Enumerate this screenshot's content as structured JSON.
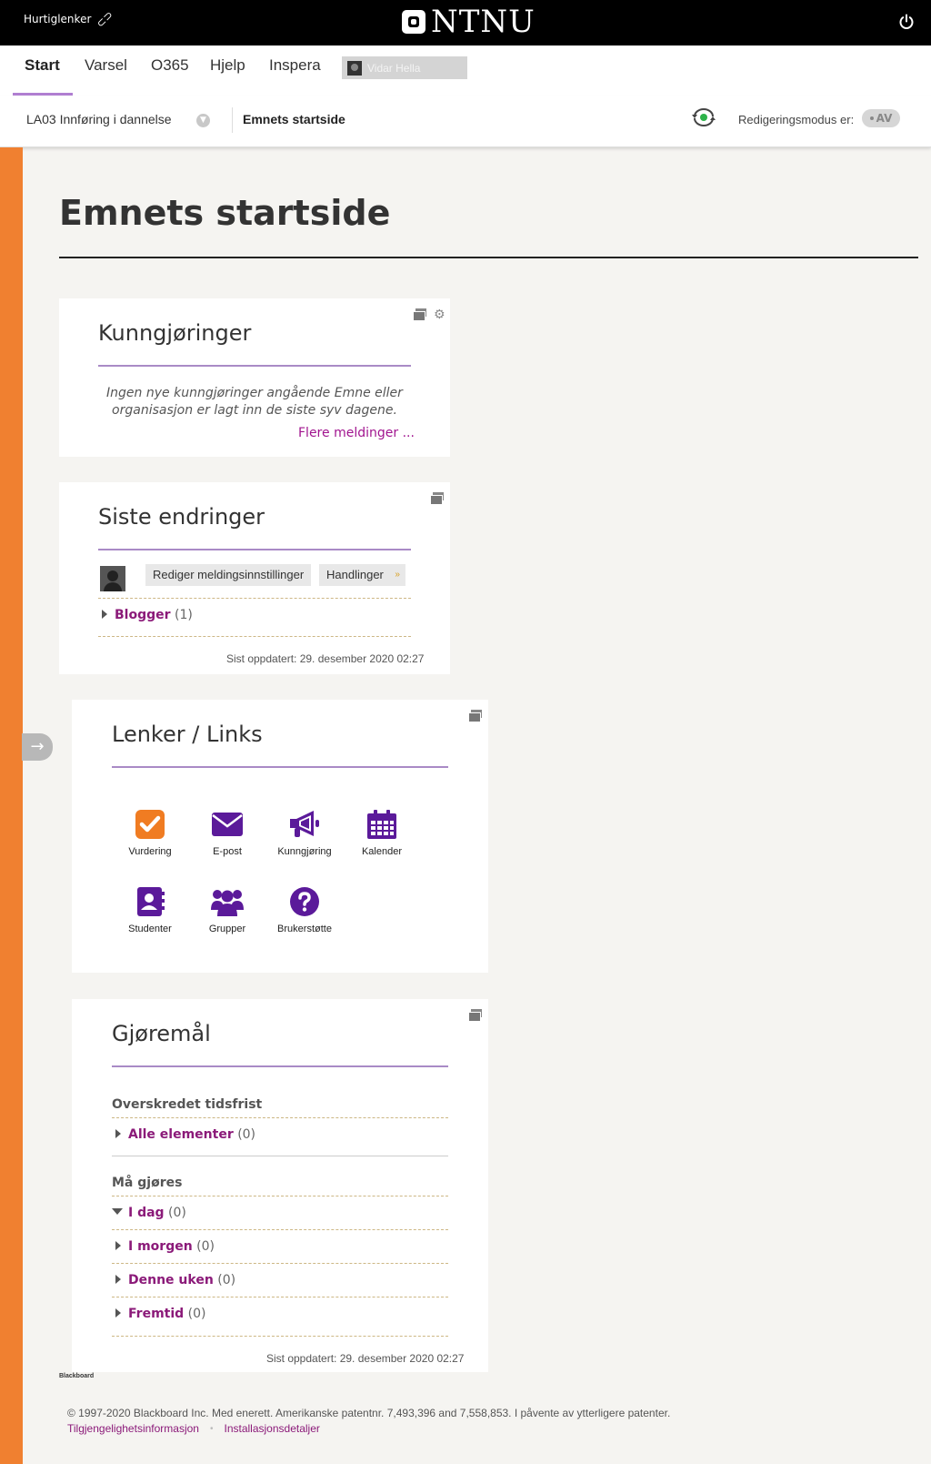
{
  "topbar": {
    "quicklinks_label": "Hurtiglenker",
    "logo_text": "NTNU",
    "power_icon": "power-icon"
  },
  "nav": {
    "tabs": [
      {
        "label": "Start",
        "active": true
      },
      {
        "label": "Varsel",
        "active": false
      },
      {
        "label": "O365",
        "active": false
      },
      {
        "label": "Hjelp",
        "active": false
      },
      {
        "label": "Inspera",
        "active": false
      }
    ],
    "user_name": "Vidar Hella",
    "accent": "#b07ed1"
  },
  "breadcrumb": {
    "course": "LA03 Innføring i dannelse",
    "current": "Emnets startside",
    "edit_mode_label": "Redigeringsmodus er:",
    "edit_mode_value": "AV"
  },
  "page": {
    "title": "Emnets startside"
  },
  "announcements": {
    "title": "Kunngjøringer",
    "empty_text": "Ingen nye kunngjøringer angående Emne eller organisasjon er lagt inn de siste syv dagene.",
    "more_link": "Flere meldinger ..."
  },
  "recent_changes": {
    "title": "Siste endringer",
    "edit_notifications_button": "Rediger meldingsinnstillinger",
    "actions_button": "Handlinger",
    "items": [
      {
        "label": "Blogger",
        "count": "(1)"
      }
    ],
    "stamp_prefix": "Sist oppdatert: 29. desember 2020 02:27",
    "stamp_overlay": "Siste oppdatert 29. desember",
    "stamp_overlay_time": "0 02:27"
  },
  "links": {
    "title": "Lenker / Links",
    "items": [
      {
        "label": "Vurdering",
        "icon": "checkbox-icon"
      },
      {
        "label": "E-post",
        "icon": "envelope-icon"
      },
      {
        "label": "Kunngjøring",
        "icon": "megaphone-icon"
      },
      {
        "label": "Kalender",
        "icon": "calendar-icon"
      },
      {
        "label": "Studenter",
        "icon": "contact-book-icon"
      },
      {
        "label": "Grupper",
        "icon": "users-icon"
      },
      {
        "label": "Brukerstøtte",
        "icon": "question-circle-icon"
      }
    ],
    "colors": {
      "orange": "#f07c22",
      "purple": "#5b1a9a"
    }
  },
  "todo": {
    "title": "Gjøremål",
    "overdue_label": "Overskredet tidsfrist",
    "overdue_items": [
      {
        "label": "Alle elementer",
        "count": "(0)"
      }
    ],
    "due_label": "Må gjøres",
    "due_items": [
      {
        "label": "I dag",
        "count": "(0)",
        "expanded": true
      },
      {
        "label": "I morgen",
        "count": "(0)",
        "expanded": false
      },
      {
        "label": "Denne uken",
        "count": "(0)",
        "expanded": false
      },
      {
        "label": "Fremtid",
        "count": "(0)",
        "expanded": false
      }
    ],
    "stamp_prefix": "Sist oppdatert: 29. desember 2020 02:27"
  },
  "footer": {
    "brand": "Blackboard",
    "copyright": "© 1997-2020 Blackboard Inc. Med enerett. Amerikanske patentnr. 7,493,396 and 7,558,853. I påvente av ytterligere patenter.",
    "links": [
      "Tilgjengelighetsinformasjon",
      "Installasjonsdetaljer"
    ]
  }
}
